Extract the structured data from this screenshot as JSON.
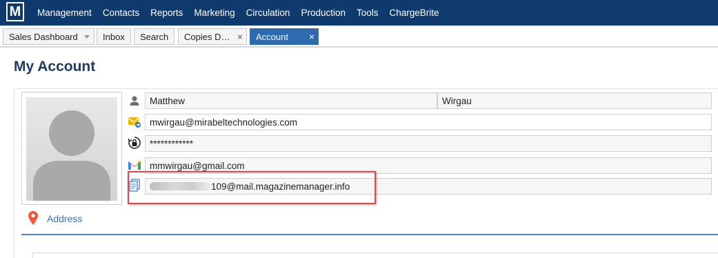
{
  "app": {
    "logo_letter": "M"
  },
  "nav": {
    "items": [
      {
        "label": "Management"
      },
      {
        "label": "Contacts"
      },
      {
        "label": "Reports"
      },
      {
        "label": "Marketing"
      },
      {
        "label": "Circulation"
      },
      {
        "label": "Production"
      },
      {
        "label": "Tools"
      },
      {
        "label": "ChargeBrite"
      }
    ]
  },
  "tabs": [
    {
      "label": "Sales Dashboard"
    },
    {
      "label": "Inbox"
    },
    {
      "label": "Search"
    },
    {
      "label": "Copies D…",
      "close": "×"
    },
    {
      "label": "Account",
      "close": "×"
    }
  ],
  "page": {
    "title": "My Account"
  },
  "profile": {
    "first_name": "Matthew",
    "last_name": "Wirgau",
    "work_email": "mwirgau@mirabeltechnologies.com",
    "password": "************",
    "gmail": "mmwirgau@gmail.com",
    "mm_email_suffix": "109@mail.magazinemanager.info"
  },
  "sections": {
    "address_label": "Address"
  },
  "colors": {
    "nav_bg": "#0e3a6e",
    "active_tab": "#2d6ab0",
    "title": "#1e3c64",
    "link": "#2f74c0",
    "highlight_border": "#e0474c"
  },
  "icons": {
    "user": "user-icon",
    "email": "email-forward-icon",
    "password": "lock-refresh-icon",
    "gmail": "gmail-icon",
    "document": "document-copy-icon",
    "pin": "location-pin-icon"
  }
}
